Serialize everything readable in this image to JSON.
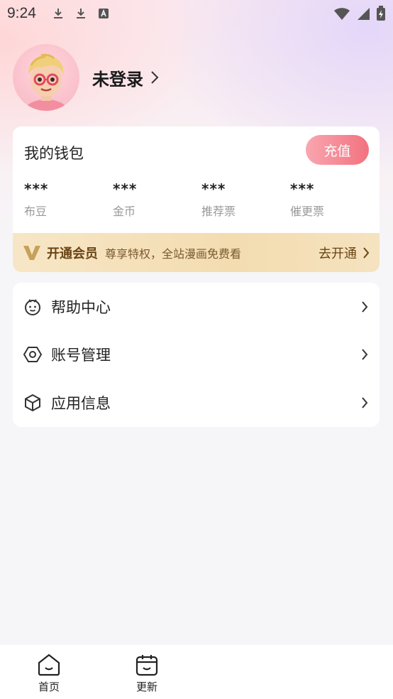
{
  "status_bar": {
    "time": "9:24"
  },
  "profile": {
    "login_text": "未登录"
  },
  "wallet": {
    "title": "我的钱包",
    "recharge_label": "充值",
    "stats": [
      {
        "value": "***",
        "label": "布豆"
      },
      {
        "value": "***",
        "label": "金币"
      },
      {
        "value": "***",
        "label": "推荐票"
      },
      {
        "value": "***",
        "label": "催更票"
      }
    ]
  },
  "vip": {
    "title": "开通会员",
    "desc": "尊享特权，全站漫画免费看",
    "action": "去开通"
  },
  "menu": {
    "items": [
      {
        "label": "帮助中心",
        "icon": "help-center-icon"
      },
      {
        "label": "账号管理",
        "icon": "account-hexagon-icon"
      },
      {
        "label": "应用信息",
        "icon": "app-info-cube-icon"
      }
    ]
  },
  "tabbar": {
    "tabs": [
      {
        "label": "首页",
        "icon": "home-icon"
      },
      {
        "label": "更新",
        "icon": "calendar-icon"
      }
    ]
  },
  "colors": {
    "recharge_start": "#f9a6b0",
    "recharge_end": "#f2727f",
    "vip_text": "#6a4514",
    "vip_bg": "#f3dcb0"
  }
}
